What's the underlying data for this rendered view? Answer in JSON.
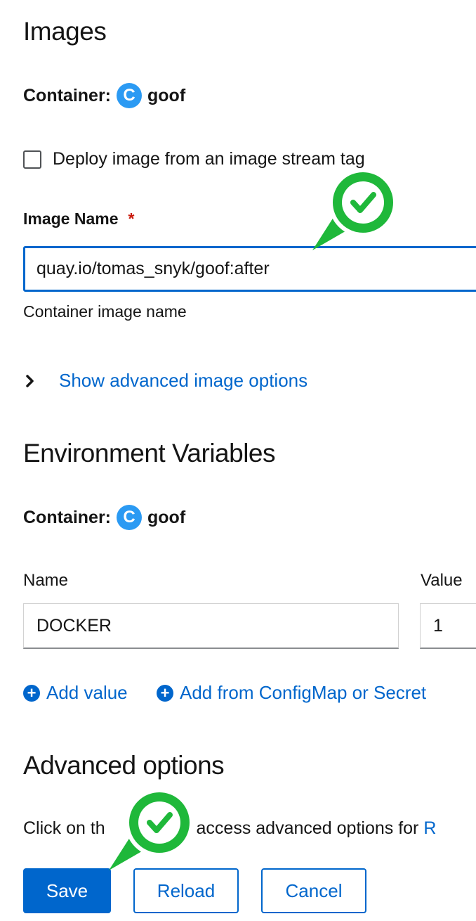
{
  "images": {
    "heading": "Images",
    "container_label": "Container:",
    "container_badge": "C",
    "container_name": "goof",
    "checkbox_label": "Deploy image from an image stream tag",
    "image_name_label": "Image Name",
    "required_marker": "*",
    "image_name_value": "quay.io/tomas_snyk/goof:after",
    "image_name_helper": "Container image name",
    "advanced_toggle_label": "Show advanced image options"
  },
  "env": {
    "heading": "Environment Variables",
    "container_label": "Container:",
    "container_badge": "C",
    "container_name": "goof",
    "name_header": "Name",
    "value_header": "Value",
    "rows": [
      {
        "name": "DOCKER",
        "value": "1"
      }
    ],
    "add_value_label": "Add value",
    "add_from_label": "Add from ConfigMap or Secret"
  },
  "advanced": {
    "heading": "Advanced options",
    "text_before": "Click on th",
    "text_after": "to access advanced options for",
    "text_link_fragment": "R"
  },
  "footer": {
    "save_label": "Save",
    "reload_label": "Reload",
    "cancel_label": "Cancel"
  },
  "colors": {
    "accent": "#0066cc",
    "badge": "#2b9af3",
    "check_pin": "#1fb83a"
  },
  "icons": {
    "checkmark_pin": "check-pin-icon",
    "chevron": "chevron-right-icon",
    "plus_circle": "plus-circle-icon"
  }
}
